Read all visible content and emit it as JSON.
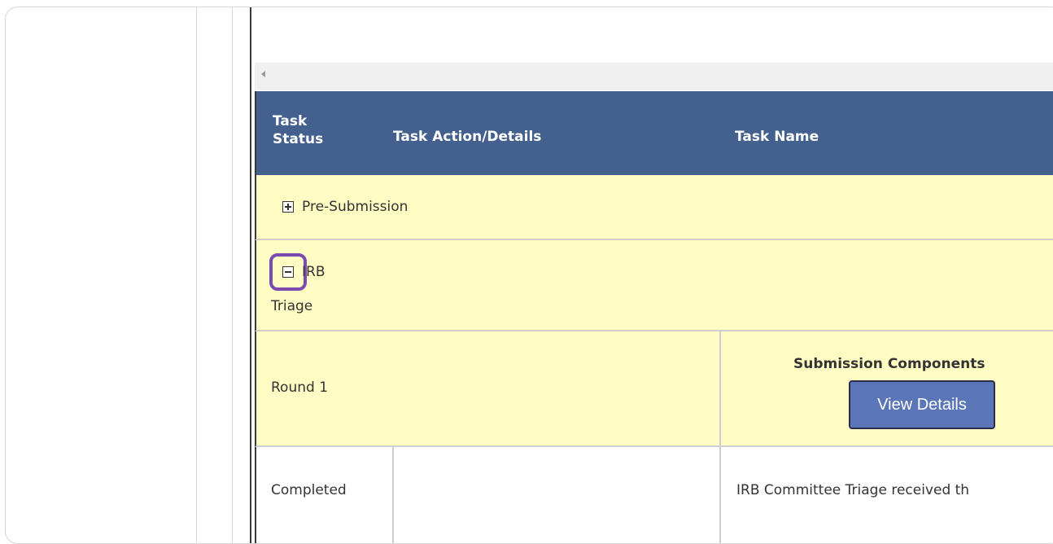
{
  "table": {
    "headers": {
      "task_status": "Task Status",
      "task_action": "Task Action/Details",
      "task_name": "Task Name"
    },
    "groups": [
      {
        "label": "Pre-Submission",
        "expanded": false
      },
      {
        "label_line1": "IRB",
        "label_line2": "Triage",
        "expanded": true
      }
    ],
    "round": {
      "label": "Round 1",
      "components_title": "Submission Components",
      "view_details_label": "View Details"
    },
    "tasks": [
      {
        "status": "Completed",
        "action": "",
        "name": "IRB Committee Triage received th"
      }
    ]
  },
  "colors": {
    "header_bg": "#44608f",
    "row_bg": "#fffdc4",
    "button_bg": "#5b76b8",
    "highlight": "#7b4bb0"
  },
  "icons": {
    "expand": "plus-box-icon",
    "collapse": "minus-box-icon",
    "scroll_left": "caret-left-icon"
  }
}
